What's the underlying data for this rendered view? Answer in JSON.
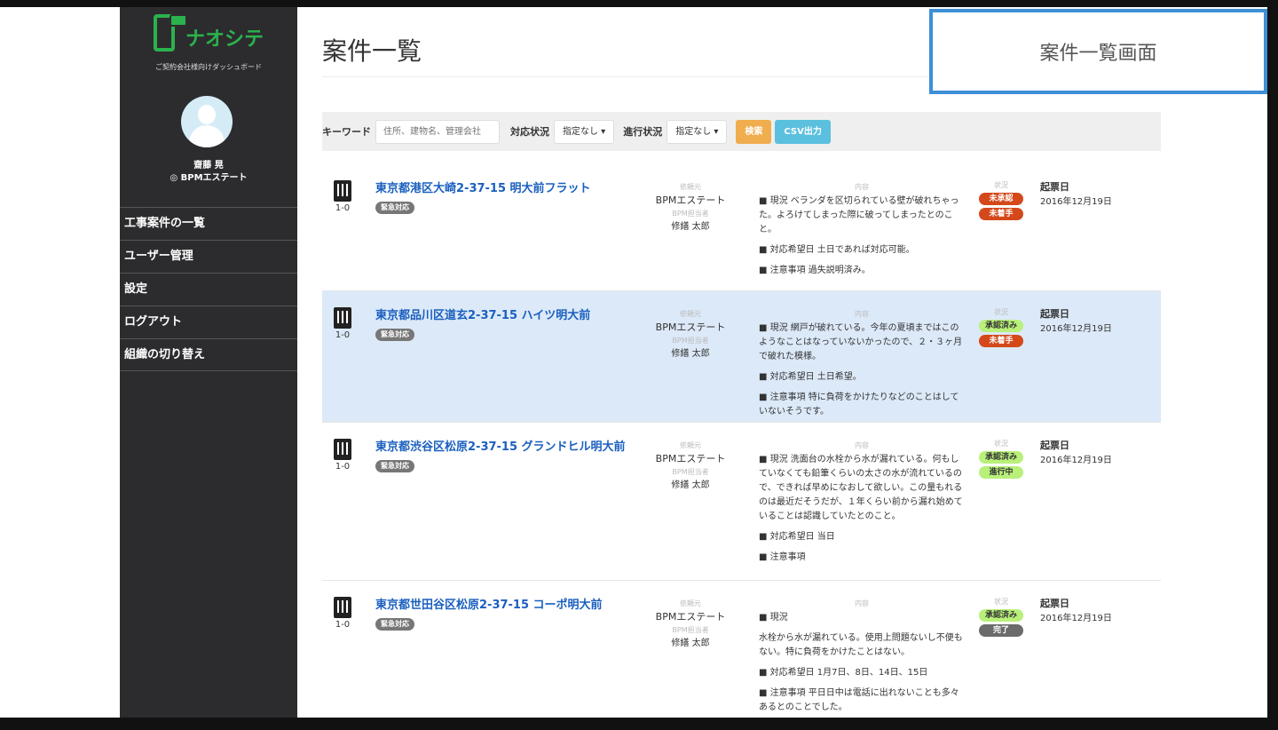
{
  "brand": {
    "name": "ナオシテ",
    "tagline": "ご契約会社様向けダッシュボード"
  },
  "user": {
    "name": "齋藤 晃",
    "org": "◎ BPMエステート"
  },
  "menu": [
    "工事案件の一覧",
    "ユーザー管理",
    "設定",
    "ログアウト",
    "組織の切り替え"
  ],
  "page_title": "案件一覧",
  "callout": "案件一覧画面",
  "search": {
    "keyword_label": "キーワード",
    "keyword_placeholder": "住所、建物名、管理会社",
    "status_label": "対応状況",
    "status_value": "指定なし ▾",
    "progress_label": "進行状況",
    "progress_value": "指定なし ▾",
    "search_button": "検索",
    "csv_button": "CSV出力"
  },
  "labels": {
    "requester": "依頼元",
    "manager": "BPM担当者",
    "content": "内容",
    "status": "状況",
    "date": "起票日"
  },
  "colors": {
    "red": "#d4481a",
    "green": "#b8f07a",
    "gray": "#6b6b6b",
    "orange": "#f0ad4e",
    "blue": "#5bc0de"
  },
  "rows": [
    {
      "floor": "1-0",
      "title": "東京都港区大崎2-37-15 明大前フラット",
      "badge": "緊急対応",
      "requester": "BPMエステート",
      "manager": "修繕 太郎",
      "content": [
        "■ 現況 ベランダを区切られている壁が破れちゃった。よろけてしまった際に破ってしまったとのこと。",
        "■ 対応希望日 土日であれば対応可能。",
        "■ 注意事項 過失説明済み。"
      ],
      "status": [
        {
          "text": "未承認",
          "c": "red"
        },
        {
          "text": "未着手",
          "c": "red"
        }
      ],
      "date": "2016年12月19日"
    },
    {
      "floor": "1-0",
      "title": "東京都品川区道玄2-37-15 ハイツ明大前",
      "badge": "緊急対応",
      "requester": "BPMエステート",
      "manager": "修繕 太郎",
      "content": [
        "■ 現況 網戸が破れている。今年の夏頃まではこのようなことはなっていないかったので、２・３ヶ月で破れた模様。",
        "■ 対応希望日 土日希望。",
        "■ 注意事項 特に負荷をかけたりなどのことはしていないそうです。"
      ],
      "status": [
        {
          "text": "承認済み",
          "c": "green"
        },
        {
          "text": "未着手",
          "c": "red"
        }
      ],
      "date": "2016年12月19日"
    },
    {
      "floor": "1-0",
      "title": "東京都渋谷区松原2-37-15 グランドヒル明大前",
      "badge": "緊急対応",
      "requester": "BPMエステート",
      "manager": "修繕 太郎",
      "content": [
        "■ 現況 洗面台の水栓から水が漏れている。何もしていなくても鉛筆くらいの太さの水が流れているので、できれば早めになおして欲しい。この量もれるのは最近だそうだが、１年くらい前から漏れ始めていることは認識していたとのこと。",
        "■ 対応希望日 当日",
        "■ 注意事項"
      ],
      "status": [
        {
          "text": "承認済み",
          "c": "green"
        },
        {
          "text": "進行中",
          "c": "green"
        }
      ],
      "date": "2016年12月19日"
    },
    {
      "floor": "1-0",
      "title": "東京都世田谷区松原2-37-15 コーポ明大前",
      "badge": "緊急対応",
      "requester": "BPMエステート",
      "manager": "修繕 太郎",
      "content": [
        "■ 現況",
        "水栓から水が漏れている。使用上問題ないし不便もない。特に負荷をかけたことはない。",
        "■ 対応希望日 1月7日、8日、14日、15日",
        "■ 注意事項 平日日中は電話に出れないことも多々あるとのことでした。"
      ],
      "status": [
        {
          "text": "承認済み",
          "c": "green"
        },
        {
          "text": "完了",
          "c": "gray"
        }
      ],
      "date": "2016年12月19日"
    }
  ]
}
